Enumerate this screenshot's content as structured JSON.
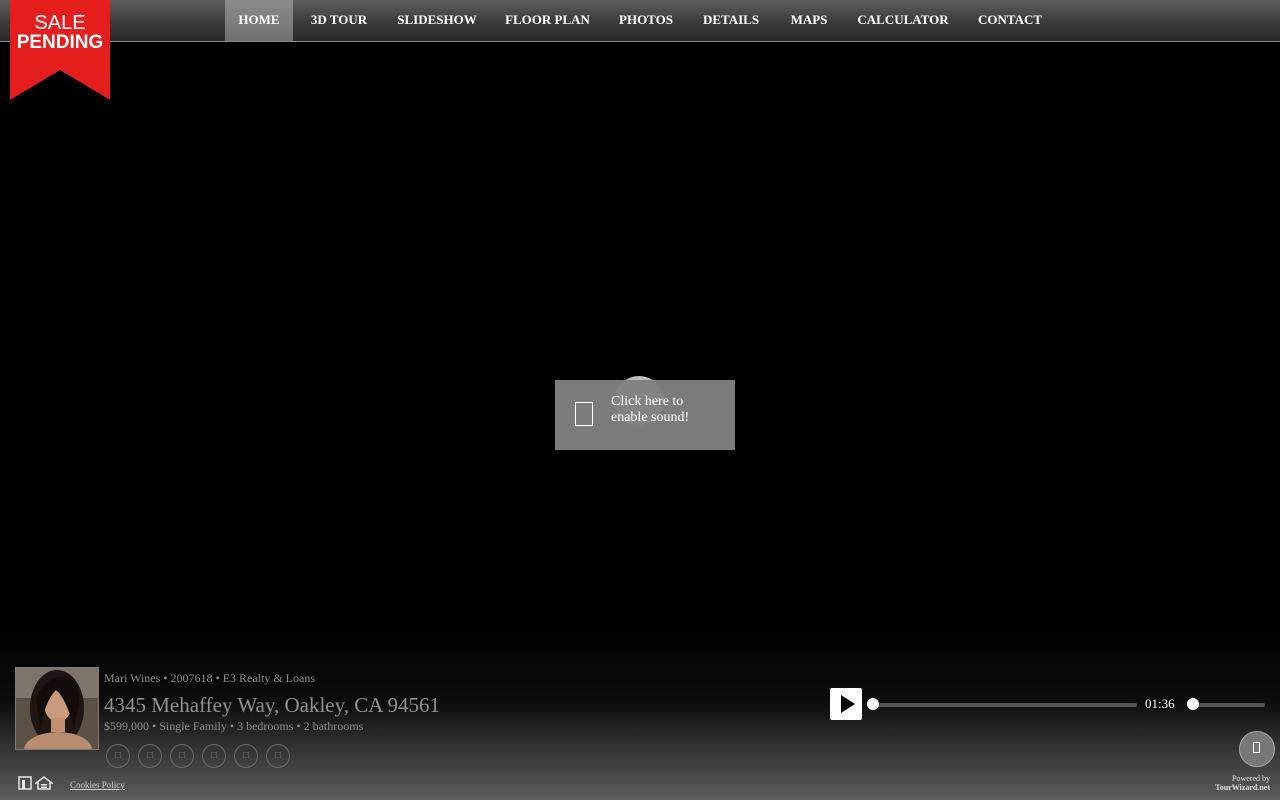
{
  "ribbon": {
    "line1": "SALE",
    "line2": "PENDING",
    "color": "#e41d1d"
  },
  "nav": {
    "items": [
      {
        "label": "HOME",
        "active": true
      },
      {
        "label": "3D TOUR"
      },
      {
        "label": "SLIDESHOW"
      },
      {
        "label": "FLOOR PLAN"
      },
      {
        "label": "PHOTOS"
      },
      {
        "label": "DETAILS"
      },
      {
        "label": "MAPS"
      },
      {
        "label": "CALCULATOR"
      },
      {
        "label": "CONTACT"
      }
    ]
  },
  "sound_prompt": {
    "text": "Click here to enable sound!"
  },
  "listing": {
    "agent_line": "Mari Wines • 2007618 • E3 Realty & Loans",
    "address": "4345 Mehaffey Way, Oakley, CA 94561",
    "facts": "$599,000 • Single Family • 3 bedrooms • 2 bathrooms"
  },
  "social_icons": [
    "icon",
    "icon",
    "icon",
    "icon",
    "icon",
    "icon"
  ],
  "player": {
    "time": "01:36",
    "progress": 0,
    "volume": 0
  },
  "footer": {
    "cookies": "Cookies Policy",
    "powered_by": "Powered by",
    "powered_site": "TourWizard.net"
  }
}
